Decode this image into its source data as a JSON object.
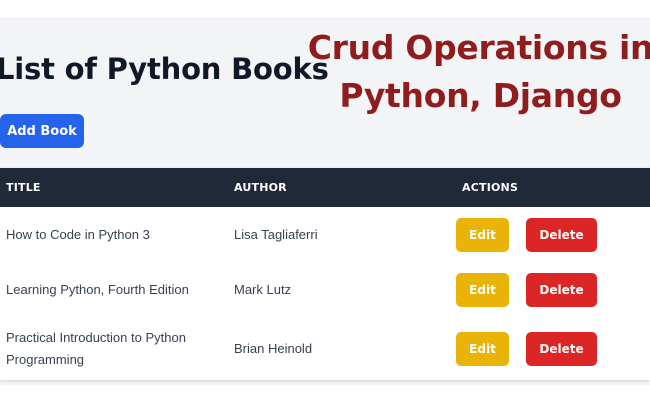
{
  "page": {
    "title": "List of Python Books",
    "add_button_label": "Add Book"
  },
  "overlay": {
    "line1": "Crud Operations in",
    "line2": "Python, Django",
    "color": "#8f1d1d"
  },
  "table": {
    "headers": {
      "title": "TITLE",
      "author": "AUTHOR",
      "actions": "ACTIONS"
    },
    "rows": [
      {
        "title": "How to Code in Python 3",
        "author": "Lisa Tagliaferri",
        "edit": "Edit",
        "delete": "Delete"
      },
      {
        "title": "Learning Python, Fourth Edition",
        "author": "Mark Lutz",
        "edit": "Edit",
        "delete": "Delete"
      },
      {
        "title": "Practical Introduction to Python Programming",
        "author": "Brian Heinold",
        "edit": "Edit",
        "delete": "Delete"
      }
    ]
  },
  "colors": {
    "add_button": "#2563eb",
    "header_bg": "#1f2937",
    "edit_button": "#eab308",
    "delete_button": "#dc2626"
  }
}
